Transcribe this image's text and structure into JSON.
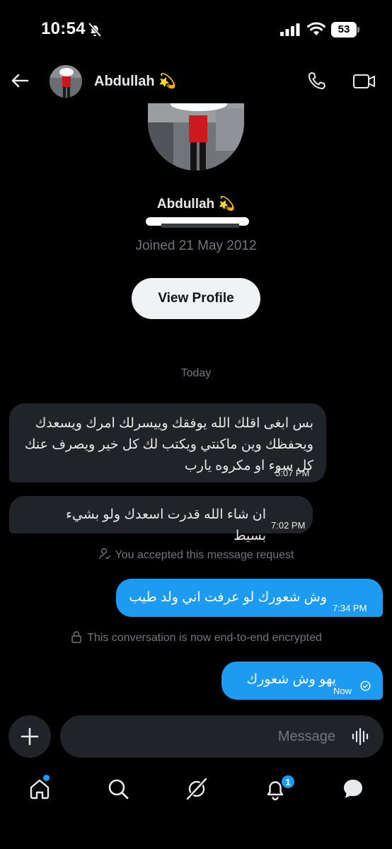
{
  "status_bar": {
    "time": "10:54",
    "battery": "53"
  },
  "header": {
    "name": "Abdullah 💫"
  },
  "profile": {
    "name": "Abdullah 💫",
    "joined": "Joined 21 May 2012",
    "view_profile_label": "View Profile"
  },
  "conversation": {
    "day_label": "Today",
    "messages": [
      {
        "direction": "incoming",
        "text": "بس ابغى اقلك الله يوفقك وييسرلك امرك ويسعدك ويحفظك وين ماكنتي ويكتب لك كل خير ويصرف عنك كل سوء او مكروه يارب",
        "time": "5:07 PM"
      },
      {
        "direction": "incoming",
        "text": "ان شاء الله قدرت اسعدك ولو بشيء بسيط",
        "time": "7:02 PM"
      },
      {
        "direction": "outgoing",
        "text": "وش شعورك لو عرفت اني ولد طيب",
        "time": "7:34 PM"
      },
      {
        "direction": "outgoing",
        "text": "يهو وش شعورك",
        "time": "Now"
      }
    ],
    "system_notices": [
      "You accepted this message request",
      "This conversation is now end-to-end encrypted"
    ]
  },
  "composer": {
    "placeholder": "Message"
  },
  "tabbar": {
    "items": [
      "home-icon",
      "search-icon",
      "grok-icon",
      "notifications-icon",
      "messages-icon"
    ],
    "notifications_badge": "1"
  },
  "colors": {
    "accent": "#1d9bf0",
    "background": "#000000",
    "bubble_incoming": "#202327",
    "muted": "#71767b"
  }
}
